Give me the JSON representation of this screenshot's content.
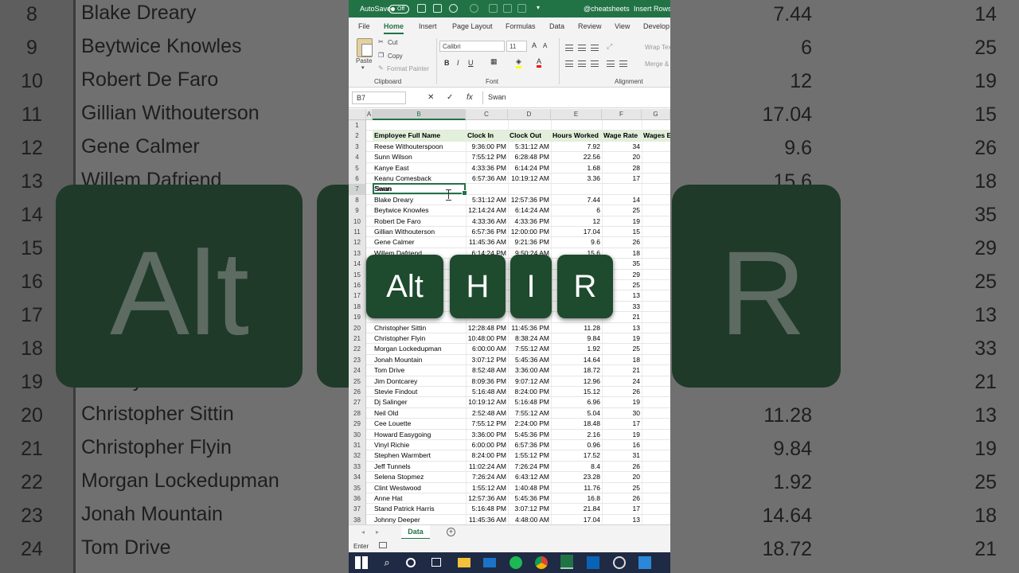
{
  "background": {
    "rows": [
      {
        "rn": "8",
        "name": "Blake Dreary"
      },
      {
        "rn": "9",
        "name": "Beytwice Knowles"
      },
      {
        "rn": "10",
        "name": "Robert De Faro"
      },
      {
        "rn": "11",
        "name": "Gillian Withouterson"
      },
      {
        "rn": "12",
        "name": "Gene Calmer"
      },
      {
        "rn": "13",
        "name": "Willem Dafriend"
      },
      {
        "rn": "14",
        "name": ""
      },
      {
        "rn": "15",
        "name": ""
      },
      {
        "rn": "16",
        "name": ""
      },
      {
        "rn": "17",
        "name": ""
      },
      {
        "rn": "18",
        "name": ""
      },
      {
        "rn": "19",
        "name": "Woody Balderson"
      },
      {
        "rn": "20",
        "name": "Christopher Sittin"
      },
      {
        "rn": "21",
        "name": "Christopher Flyin"
      },
      {
        "rn": "22",
        "name": "Morgan Lockedupman"
      },
      {
        "rn": "23",
        "name": "Jonah Mountain"
      },
      {
        "rn": "24",
        "name": "Tom Drive"
      }
    ],
    "right_rows": [
      {
        "v1": "7.44",
        "v2": "14"
      },
      {
        "v1": "6",
        "v2": "25"
      },
      {
        "v1": "12",
        "v2": "19"
      },
      {
        "v1": "17.04",
        "v2": "15"
      },
      {
        "v1": "9.6",
        "v2": "26"
      },
      {
        "v1": "15.6",
        "v2": "18"
      },
      {
        "v1": "",
        "v2": "35"
      },
      {
        "v1": "",
        "v2": "29"
      },
      {
        "v1": "",
        "v2": "25"
      },
      {
        "v1": "",
        "v2": "13"
      },
      {
        "v1": "",
        "v2": "33"
      },
      {
        "v1": "",
        "v2": "21"
      },
      {
        "v1": "11.28",
        "v2": "13"
      },
      {
        "v1": "9.84",
        "v2": "19"
      },
      {
        "v1": "1.92",
        "v2": "25"
      },
      {
        "v1": "14.64",
        "v2": "18"
      },
      {
        "v1": "18.72",
        "v2": "21"
      }
    ],
    "big_key_left": "Alt",
    "big_key_right": "R"
  },
  "titlebar": {
    "autosave_label": "AutoSave",
    "autosave_state": "Off",
    "account": "@cheatsheets",
    "context": "Insert Rows"
  },
  "tabs": [
    "File",
    "Home",
    "Insert",
    "Page Layout",
    "Formulas",
    "Data",
    "Review",
    "View",
    "Develop"
  ],
  "ribbon": {
    "paste": "Paste",
    "cut": "Cut",
    "copy": "Copy",
    "format_painter": "Format Painter",
    "clipboard_group": "Clipboard",
    "font_name": "Calibri",
    "font_size": "11",
    "font_group": "Font",
    "wrap_text": "Wrap Tex",
    "merge": "Merge &",
    "alignment_group": "Alignment"
  },
  "formula": {
    "name_box": "B7",
    "value": "Swan"
  },
  "columns": [
    "A",
    "B",
    "C",
    "D",
    "E",
    "F",
    "G"
  ],
  "header_row": {
    "b": "Employee Full Name",
    "c": "Clock In",
    "d": "Clock Out",
    "e": "Hours Worked",
    "f": "Wage Rate",
    "g": "Wages E"
  },
  "rows": [
    {
      "n": "3",
      "b": "Reese Withouterspoon",
      "c": "9:36:00 PM",
      "d": "5:31:12 AM",
      "e": "7.92",
      "f": "34"
    },
    {
      "n": "4",
      "b": "Sunn Wilson",
      "c": "7:55:12 PM",
      "d": "6:28:48 PM",
      "e": "22.56",
      "f": "20"
    },
    {
      "n": "5",
      "b": "Kanye East",
      "c": "4:33:36 PM",
      "d": "6:14:24 PM",
      "e": "1.68",
      "f": "28"
    },
    {
      "n": "6",
      "b": "Keanu Comesback",
      "c": "6:57:36 AM",
      "d": "10:19:12 AM",
      "e": "3.36",
      "f": "17"
    },
    {
      "n": "7",
      "b": "Swan",
      "c": "",
      "d": "",
      "e": "",
      "f": ""
    },
    {
      "n": "8",
      "b": "Blake Dreary",
      "c": "5:31:12 AM",
      "d": "12:57:36 PM",
      "e": "7.44",
      "f": "14"
    },
    {
      "n": "9",
      "b": "Beytwice Knowles",
      "c": "12:14:24 AM",
      "d": "6:14:24 AM",
      "e": "6",
      "f": "25"
    },
    {
      "n": "10",
      "b": "Robert De Faro",
      "c": "4:33:36 AM",
      "d": "4:33:36 PM",
      "e": "12",
      "f": "19"
    },
    {
      "n": "11",
      "b": "Gillian Withouterson",
      "c": "6:57:36 PM",
      "d": "12:00:00 PM",
      "e": "17.04",
      "f": "15"
    },
    {
      "n": "12",
      "b": "Gene Calmer",
      "c": "11:45:36 AM",
      "d": "9:21:36 PM",
      "e": "9.6",
      "f": "26"
    },
    {
      "n": "13",
      "b": "Willem Dafriend",
      "c": "6:14:24 PM",
      "d": "9:50:24 AM",
      "e": "15.6",
      "f": "18"
    },
    {
      "n": "14",
      "b": "",
      "c": "",
      "d": "",
      "e": "",
      "f": "35"
    },
    {
      "n": "15",
      "b": "",
      "c": "",
      "d": "",
      "e": "",
      "f": "29"
    },
    {
      "n": "16",
      "b": "",
      "c": "",
      "d": "",
      "e": "",
      "f": "25"
    },
    {
      "n": "17",
      "b": "",
      "c": "",
      "d": "",
      "e": "",
      "f": "13"
    },
    {
      "n": "18",
      "b": "",
      "c": "",
      "d": "",
      "e": "",
      "f": "33"
    },
    {
      "n": "19",
      "b": "",
      "c": "",
      "d": "",
      "e": "",
      "f": "21"
    },
    {
      "n": "20",
      "b": "Christopher Sittin",
      "c": "12:28:48 PM",
      "d": "11:45:36 PM",
      "e": "11.28",
      "f": "13"
    },
    {
      "n": "21",
      "b": "Christopher Flyin",
      "c": "10:48:00 PM",
      "d": "8:38:24 AM",
      "e": "9.84",
      "f": "19"
    },
    {
      "n": "22",
      "b": "Morgan Lockedupman",
      "c": "6:00:00 AM",
      "d": "7:55:12 AM",
      "e": "1.92",
      "f": "25"
    },
    {
      "n": "23",
      "b": "Jonah Mountain",
      "c": "3:07:12 PM",
      "d": "5:45:36 AM",
      "e": "14.64",
      "f": "18"
    },
    {
      "n": "24",
      "b": "Tom Drive",
      "c": "8:52:48 AM",
      "d": "3:36:00 AM",
      "e": "18.72",
      "f": "21"
    },
    {
      "n": "25",
      "b": "Jim Dontcarey",
      "c": "8:09:36 PM",
      "d": "9:07:12 AM",
      "e": "12.96",
      "f": "24"
    },
    {
      "n": "26",
      "b": "Stevie Findout",
      "c": "5:16:48 AM",
      "d": "8:24:00 PM",
      "e": "15.12",
      "f": "26"
    },
    {
      "n": "27",
      "b": "Dj Salinger",
      "c": "10:19:12 AM",
      "d": "5:16:48 PM",
      "e": "6.96",
      "f": "19"
    },
    {
      "n": "28",
      "b": "Neil Old",
      "c": "2:52:48 AM",
      "d": "7:55:12 AM",
      "e": "5.04",
      "f": "30"
    },
    {
      "n": "29",
      "b": "Cee Louette",
      "c": "7:55:12 PM",
      "d": "2:24:00 PM",
      "e": "18.48",
      "f": "17"
    },
    {
      "n": "30",
      "b": "Howard Easygoing",
      "c": "3:36:00 PM",
      "d": "5:45:36 PM",
      "e": "2.16",
      "f": "19"
    },
    {
      "n": "31",
      "b": "Vinyl Richie",
      "c": "6:00:00 PM",
      "d": "6:57:36 PM",
      "e": "0.96",
      "f": "16"
    },
    {
      "n": "32",
      "b": "Stephen Warmbert",
      "c": "8:24:00 PM",
      "d": "1:55:12 PM",
      "e": "17.52",
      "f": "31"
    },
    {
      "n": "33",
      "b": "Jeff Tunnels",
      "c": "11:02:24 AM",
      "d": "7:26:24 PM",
      "e": "8.4",
      "f": "26"
    },
    {
      "n": "34",
      "b": "Selena Stopmez",
      "c": "7:26:24 AM",
      "d": "6:43:12 AM",
      "e": "23.28",
      "f": "20"
    },
    {
      "n": "35",
      "b": "Clint Westwood",
      "c": "1:55:12 AM",
      "d": "1:40:48 PM",
      "e": "11.76",
      "f": "25"
    },
    {
      "n": "36",
      "b": "Anne Hat",
      "c": "12:57:36 AM",
      "d": "5:45:36 PM",
      "e": "16.8",
      "f": "26"
    },
    {
      "n": "37",
      "b": "Stand Patrick Harris",
      "c": "5:16:48 PM",
      "d": "3:07:12 PM",
      "e": "21.84",
      "f": "17"
    },
    {
      "n": "38",
      "b": "Johnny Deeper",
      "c": "11:45:36 AM",
      "d": "4:48:00 AM",
      "e": "17.04",
      "f": "13"
    }
  ],
  "sheet_tab": "Data",
  "status": "Enter",
  "overlay_keys": [
    "Alt",
    "H",
    "I",
    "R"
  ],
  "colors": {
    "excel_green": "#217346",
    "key_green": "#1e4a2e",
    "header_fill": "#e2efda"
  }
}
